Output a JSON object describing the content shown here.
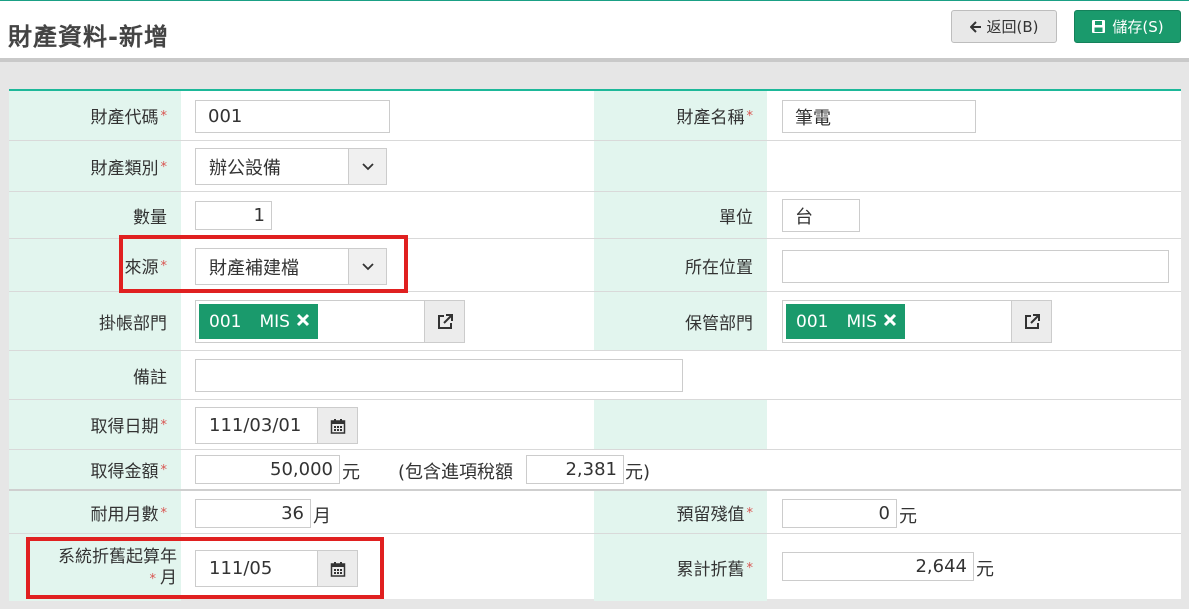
{
  "header": {
    "title": "財產資料-新增",
    "back_label": "返回(B)",
    "save_label": "儲存(S)",
    "save_color": "#1a9a6c"
  },
  "form": {
    "asset_code": {
      "label": "財產代碼",
      "value": "001",
      "required": true
    },
    "asset_name": {
      "label": "財產名稱",
      "value": "筆電",
      "required": true
    },
    "asset_category": {
      "label": "財產類別",
      "value": "辦公設備",
      "required": true
    },
    "quantity": {
      "label": "數量",
      "value": "1"
    },
    "unit": {
      "label": "單位",
      "value": "台"
    },
    "source": {
      "label": "來源",
      "value": "財產補建檔",
      "required": true
    },
    "location": {
      "label": "所在位置",
      "value": ""
    },
    "account_dept": {
      "label": "掛帳部門",
      "tag_code": "001",
      "tag_name": "MIS"
    },
    "custody_dept": {
      "label": "保管部門",
      "tag_code": "001",
      "tag_name": "MIS"
    },
    "remark": {
      "label": "備註",
      "value": ""
    },
    "acquire_date": {
      "label": "取得日期",
      "value": "111/03/01",
      "required": true
    },
    "acquire_amount": {
      "label": "取得金額",
      "value": "50,000",
      "unit": "元",
      "required": true,
      "tax_prefix": "(包含進項稅額",
      "tax_value": "2,381",
      "tax_suffix": "元)"
    },
    "useful_months": {
      "label": "耐用月數",
      "value": "36",
      "unit": "月",
      "required": true
    },
    "residual_value": {
      "label": "預留殘值",
      "value": "0",
      "unit": "元",
      "required": true
    },
    "depr_start": {
      "label_line1": "系統折舊起算年",
      "label_line2": "月",
      "value": "111/05",
      "required": true
    },
    "accum_depr": {
      "label": "累計折舊",
      "value": "2,644",
      "unit": "元",
      "required": true
    }
  },
  "colors": {
    "accent": "#1db899",
    "label_bg": "#e2f5ee",
    "required_mark": "#d9534f",
    "highlight": "#e02020"
  },
  "required_mark": "*"
}
